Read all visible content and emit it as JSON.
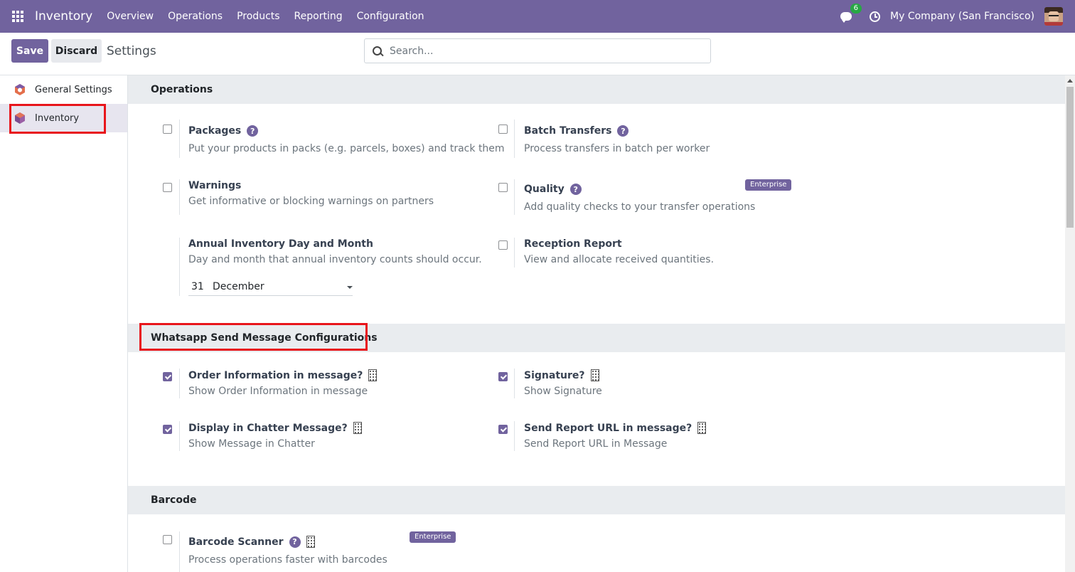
{
  "navbar": {
    "app_name": "Inventory",
    "menu": [
      "Overview",
      "Operations",
      "Products",
      "Reporting",
      "Configuration"
    ],
    "chat_count": "6",
    "company": "My Company (San Francisco)"
  },
  "control": {
    "save_label": "Save",
    "discard_label": "Discard",
    "breadcrumb": "Settings",
    "search_placeholder": "Search..."
  },
  "sidebar": {
    "items": [
      {
        "label": "General Settings"
      },
      {
        "label": "Inventory"
      }
    ]
  },
  "sections": {
    "operations": {
      "title": "Operations",
      "packages": {
        "title": "Packages",
        "desc": "Put your products in packs (e.g. parcels, boxes) and track them",
        "checked": false
      },
      "batch": {
        "title": "Batch Transfers",
        "desc": "Process transfers in batch per worker",
        "checked": false
      },
      "warnings": {
        "title": "Warnings",
        "desc": "Get informative or blocking warnings on partners",
        "checked": false
      },
      "quality": {
        "title": "Quality",
        "desc": "Add quality checks to your transfer operations",
        "checked": false,
        "badge": "Enterprise"
      },
      "annual": {
        "title": "Annual Inventory Day and Month",
        "desc": "Day and month that annual inventory counts should occur.",
        "day": "31",
        "month": "December"
      },
      "reception": {
        "title": "Reception Report",
        "desc": "View and allocate received quantities.",
        "checked": false
      }
    },
    "whatsapp": {
      "title": "Whatsapp Send Message Configurations",
      "order_info": {
        "title": "Order Information in message?",
        "desc": "Show Order Information in message",
        "checked": true
      },
      "signature": {
        "title": "Signature?",
        "desc": "Show Signature",
        "checked": true
      },
      "chatter": {
        "title": "Display in Chatter Message?",
        "desc": "Show Message in Chatter",
        "checked": true
      },
      "report_url": {
        "title": "Send Report URL in message?",
        "desc": "Send Report URL in Message",
        "checked": true
      }
    },
    "barcode": {
      "title": "Barcode",
      "scanner": {
        "title": "Barcode Scanner",
        "desc": "Process operations faster with barcodes",
        "checked": false,
        "badge": "Enterprise"
      }
    }
  },
  "colors": {
    "primary": "#71639e",
    "highlight": "#e8151b"
  }
}
